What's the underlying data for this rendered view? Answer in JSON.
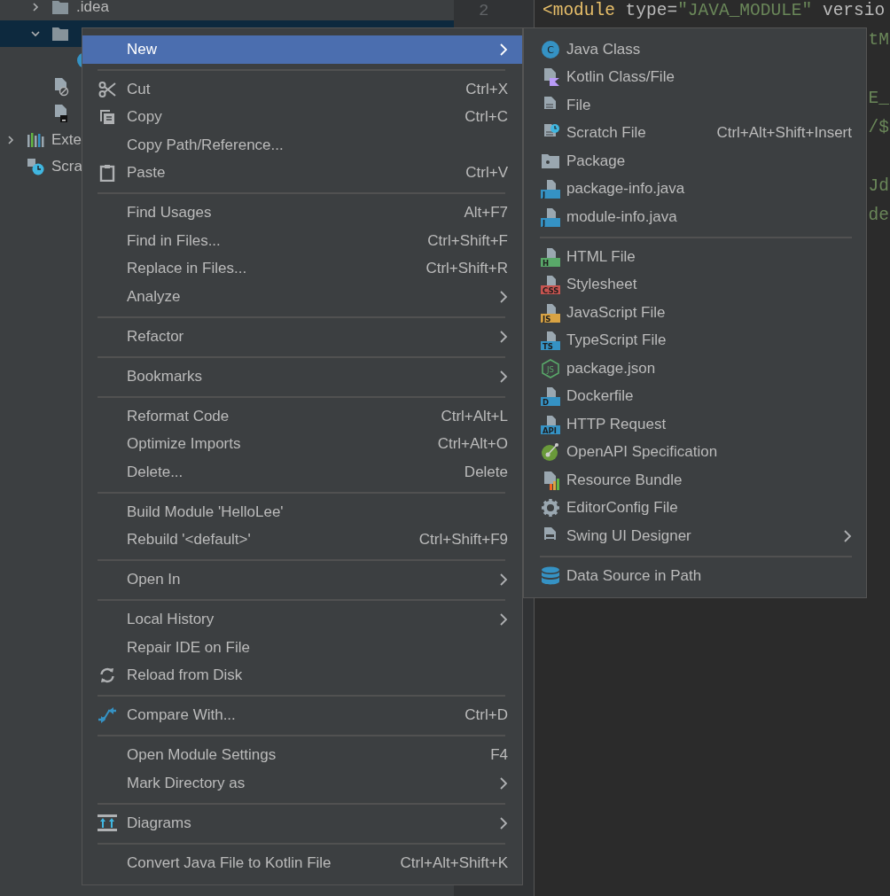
{
  "tree": {
    "project_children": [
      {
        "label": ".idea",
        "kind": "folder",
        "expanded": false,
        "selected": false
      },
      {
        "kind": "folder",
        "expanded": true,
        "selected": true,
        "children": [
          {
            "kind": "class",
            "selected": false
          }
        ]
      },
      {
        "kind": "ignore-file",
        "selected": false
      },
      {
        "kind": "module-file",
        "selected": false
      }
    ],
    "items": [
      {
        "label": "Exte",
        "kind": "libraries",
        "expanded": false,
        "selected": false
      },
      {
        "label": "Scra",
        "kind": "scratches",
        "selected": false
      }
    ]
  },
  "gutter": {
    "line_number": "2"
  },
  "editor": {
    "first_line": [
      {
        "text": "<module",
        "kind": "tag"
      },
      {
        "text": "type=",
        "kind": "attr"
      },
      {
        "text": "\"JAVA_MODULE\"",
        "kind": "string"
      },
      {
        "text": "versio",
        "kind": "attr"
      }
    ],
    "fragments": [
      {
        "text": "tM",
        "kind": "string"
      },
      {
        "kind": "blank"
      },
      {
        "text": "E_",
        "kind": "string"
      },
      {
        "text": "/$",
        "kind": "string"
      },
      {
        "kind": "blank"
      },
      {
        "text": "Jd",
        "kind": "string"
      },
      {
        "text": "de",
        "kind": "string"
      }
    ]
  },
  "context_menu": {
    "groups": [
      [
        {
          "label": "New",
          "submenu": true,
          "selected": true,
          "kind": "plain"
        }
      ],
      [
        {
          "label": "Cut",
          "shortcut": "Ctrl+X",
          "submenu": false,
          "selected": false,
          "kind": "cut"
        },
        {
          "label": "Copy",
          "shortcut": "Ctrl+C",
          "submenu": false,
          "selected": false,
          "kind": "copy"
        },
        {
          "label": "Copy Path/Reference...",
          "submenu": false,
          "selected": false,
          "kind": "plain"
        },
        {
          "label": "Paste",
          "shortcut": "Ctrl+V",
          "submenu": false,
          "selected": false,
          "kind": "paste"
        }
      ],
      [
        {
          "label": "Find Usages",
          "shortcut": "Alt+F7",
          "submenu": false,
          "selected": false,
          "kind": "plain"
        },
        {
          "label": "Find in Files...",
          "shortcut": "Ctrl+Shift+F",
          "submenu": false,
          "selected": false,
          "kind": "plain"
        },
        {
          "label": "Replace in Files...",
          "shortcut": "Ctrl+Shift+R",
          "submenu": false,
          "selected": false,
          "kind": "plain"
        },
        {
          "label": "Analyze",
          "submenu": true,
          "selected": false,
          "kind": "plain"
        }
      ],
      [
        {
          "label": "Refactor",
          "submenu": true,
          "selected": false,
          "kind": "plain"
        }
      ],
      [
        {
          "label": "Bookmarks",
          "submenu": true,
          "selected": false,
          "kind": "plain"
        }
      ],
      [
        {
          "label": "Reformat Code",
          "shortcut": "Ctrl+Alt+L",
          "submenu": false,
          "selected": false,
          "kind": "plain"
        },
        {
          "label": "Optimize Imports",
          "shortcut": "Ctrl+Alt+O",
          "submenu": false,
          "selected": false,
          "kind": "plain"
        },
        {
          "label": "Delete...",
          "shortcut": "Delete",
          "submenu": false,
          "selected": false,
          "kind": "plain"
        }
      ],
      [
        {
          "label": "Build Module 'HelloLee'",
          "submenu": false,
          "selected": false,
          "kind": "plain"
        },
        {
          "label": "Rebuild '<default>'",
          "shortcut": "Ctrl+Shift+F9",
          "submenu": false,
          "selected": false,
          "kind": "plain"
        }
      ],
      [
        {
          "label": "Open In",
          "submenu": true,
          "selected": false,
          "kind": "plain"
        }
      ],
      [
        {
          "label": "Local History",
          "submenu": true,
          "selected": false,
          "kind": "plain"
        },
        {
          "label": "Repair IDE on File",
          "submenu": false,
          "selected": false,
          "kind": "plain"
        },
        {
          "label": "Reload from Disk",
          "submenu": false,
          "selected": false,
          "kind": "reload"
        }
      ],
      [
        {
          "label": "Compare With...",
          "shortcut": "Ctrl+D",
          "submenu": false,
          "selected": false,
          "kind": "compare"
        }
      ],
      [
        {
          "label": "Open Module Settings",
          "shortcut": "F4",
          "submenu": false,
          "selected": false,
          "kind": "plain"
        },
        {
          "label": "Mark Directory as",
          "submenu": true,
          "selected": false,
          "kind": "plain"
        }
      ],
      [
        {
          "label": "Diagrams",
          "submenu": true,
          "selected": false,
          "kind": "diagrams"
        }
      ],
      [
        {
          "label": "Convert Java File to Kotlin File",
          "shortcut": "Ctrl+Alt+Shift+K",
          "submenu": false,
          "selected": false,
          "kind": "plain"
        }
      ]
    ]
  },
  "new_submenu": {
    "groups": [
      [
        {
          "label": "Java Class",
          "kind": "class",
          "badge": "C",
          "color": "#3592c4",
          "submenu": false,
          "selected": false
        },
        {
          "label": "Kotlin Class/File",
          "kind": "kotlin",
          "submenu": false,
          "selected": false
        },
        {
          "label": "File",
          "kind": "file",
          "submenu": false,
          "selected": false
        },
        {
          "label": "Scratch File",
          "kind": "scratch",
          "shortcut": "Ctrl+Alt+Shift+Insert",
          "submenu": false,
          "selected": false
        },
        {
          "label": "Package",
          "kind": "package",
          "submenu": false,
          "selected": false
        },
        {
          "label": "package-info.java",
          "kind": "badge-file",
          "badge": "J",
          "color": "#3592c4",
          "submenu": false,
          "selected": false
        },
        {
          "label": "module-info.java",
          "kind": "badge-file",
          "badge": "J",
          "color": "#3592c4",
          "submenu": false,
          "selected": false
        }
      ],
      [
        {
          "label": "HTML File",
          "kind": "badge-file",
          "badge": "H",
          "color": "#59a869",
          "submenu": false,
          "selected": false
        },
        {
          "label": "Stylesheet",
          "kind": "badge-file",
          "badge": "CSS",
          "color": "#c75450",
          "submenu": false,
          "selected": false
        },
        {
          "label": "JavaScript File",
          "kind": "badge-file",
          "badge": "JS",
          "color": "#d9a343",
          "submenu": false,
          "selected": false
        },
        {
          "label": "TypeScript File",
          "kind": "badge-file",
          "badge": "TS",
          "color": "#3592c4",
          "submenu": false,
          "selected": false
        },
        {
          "label": "package.json",
          "kind": "nodejs",
          "badge": "JS",
          "color": "#59a869",
          "submenu": false,
          "selected": false
        },
        {
          "label": "Dockerfile",
          "kind": "badge-file",
          "badge": "D",
          "color": "#3592c4",
          "submenu": false,
          "selected": false
        },
        {
          "label": "HTTP Request",
          "kind": "badge-file",
          "badge": "API",
          "color": "#3592c4",
          "submenu": false,
          "selected": false
        },
        {
          "label": "OpenAPI Specification",
          "kind": "openapi",
          "submenu": false,
          "selected": false
        },
        {
          "label": "Resource Bundle",
          "kind": "resource",
          "submenu": false,
          "selected": false
        },
        {
          "label": "EditorConfig File",
          "kind": "gear",
          "submenu": false,
          "selected": false
        },
        {
          "label": "Swing UI Designer",
          "kind": "form",
          "submenu": true,
          "selected": false
        }
      ],
      [
        {
          "label": "Data Source in Path",
          "kind": "database",
          "submenu": false,
          "selected": false
        }
      ]
    ]
  }
}
